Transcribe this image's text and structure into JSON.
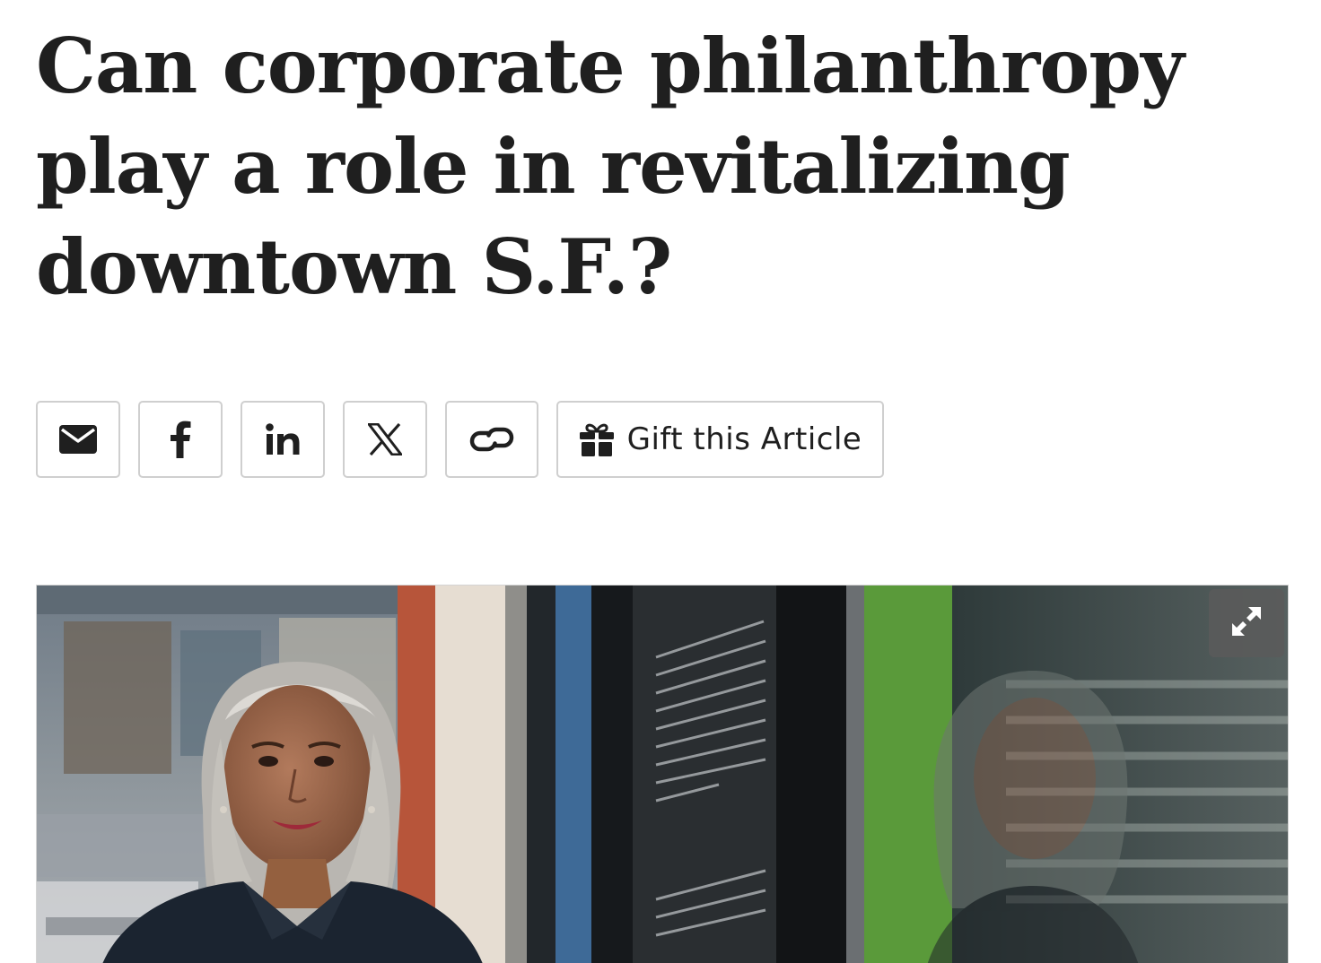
{
  "article": {
    "headline": "Can corporate philanthropy play a role in revitalizing downtown S.F.?"
  },
  "share": {
    "buttons": [
      {
        "icon": "email-icon"
      },
      {
        "icon": "facebook-icon"
      },
      {
        "icon": "linkedin-icon"
      },
      {
        "icon": "x-icon"
      },
      {
        "icon": "link-icon"
      }
    ],
    "gift": {
      "icon": "gift-icon",
      "label": "Gift this Article"
    }
  },
  "hero_image": {
    "expand_icon": "expand-icon"
  },
  "colors": {
    "text": "#1f1f1f",
    "button_border": "#cfcfcf",
    "expand_button_bg": "#5a5a5a"
  }
}
